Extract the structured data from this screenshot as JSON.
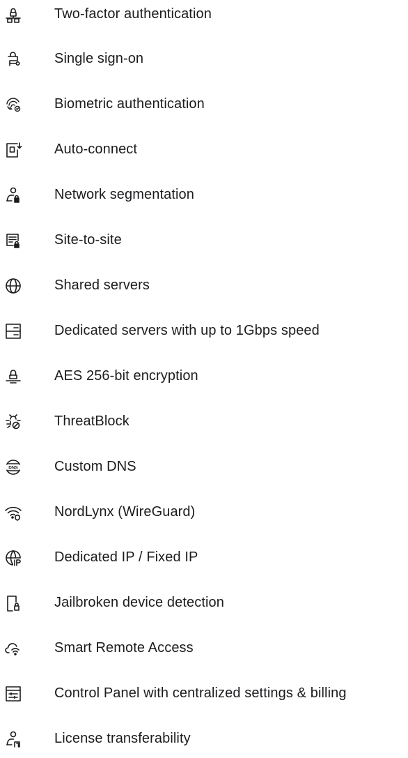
{
  "features": [
    {
      "icon": "two-factor-lock-icon",
      "label": "Two-factor authentication"
    },
    {
      "icon": "single-sign-on-icon",
      "label": "Single sign-on"
    },
    {
      "icon": "fingerprint-icon",
      "label": "Biometric authentication"
    },
    {
      "icon": "auto-connect-icon",
      "label": "Auto-connect"
    },
    {
      "icon": "user-lock-icon",
      "label": "Network segmentation"
    },
    {
      "icon": "site-lock-icon",
      "label": "Site-to-site"
    },
    {
      "icon": "globe-icon",
      "label": "Shared servers"
    },
    {
      "icon": "server-icon",
      "label": "Dedicated servers with up to 1Gbps speed"
    },
    {
      "icon": "encryption-lock-icon",
      "label": "AES 256-bit encryption"
    },
    {
      "icon": "threat-block-icon",
      "label": "ThreatBlock"
    },
    {
      "icon": "dns-globe-icon",
      "label": "Custom DNS"
    },
    {
      "icon": "wifi-shield-icon",
      "label": "NordLynx (WireGuard)"
    },
    {
      "icon": "globe-ip-icon",
      "label": "Dedicated IP / Fixed IP"
    },
    {
      "icon": "device-lock-icon",
      "label": "Jailbroken device detection"
    },
    {
      "icon": "cloud-wifi-icon",
      "label": "Smart Remote Access"
    },
    {
      "icon": "control-panel-icon",
      "label": "Control Panel with centralized settings & billing"
    },
    {
      "icon": "user-license-icon",
      "label": "License transferability"
    }
  ],
  "colors": {
    "text": "#1c1c1f",
    "icon": "#1c1c1f"
  }
}
